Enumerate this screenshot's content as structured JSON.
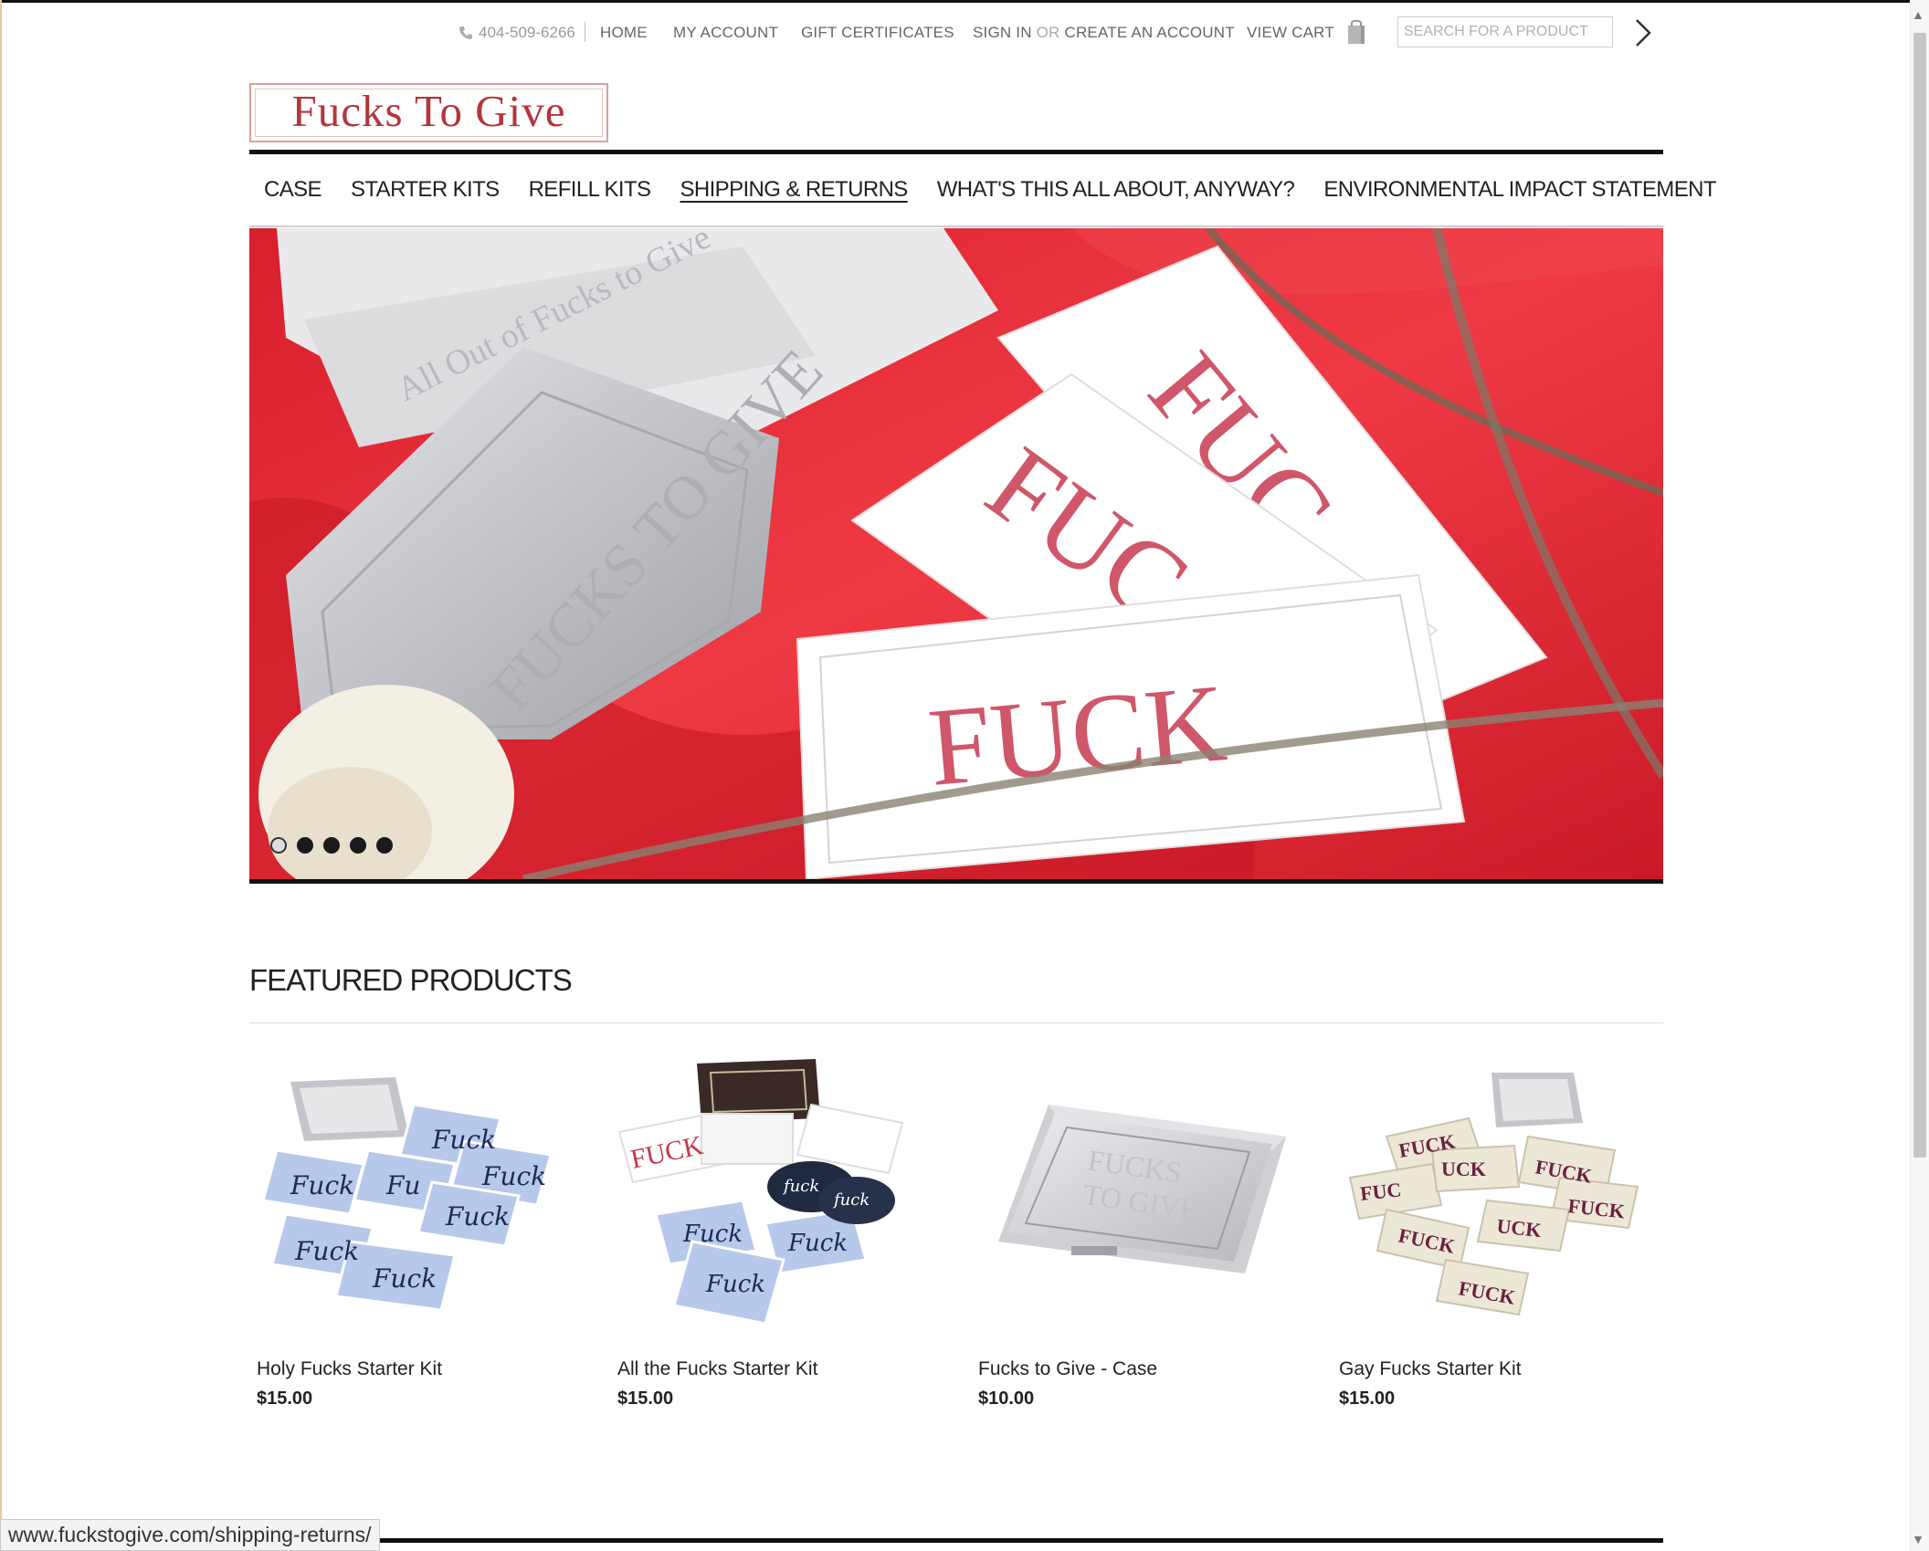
{
  "utility": {
    "phone": "404-509-6266",
    "home": "HOME",
    "my_account": "MY ACCOUNT",
    "gift_certificates": "GIFT CERTIFICATES",
    "sign_in": "SIGN IN",
    "or": "OR",
    "create_account": "CREATE AN ACCOUNT",
    "view_cart": "VIEW CART",
    "search_placeholder": "SEARCH FOR A PRODUCT"
  },
  "logo": {
    "text": "Fucks To Give"
  },
  "nav": {
    "items": [
      {
        "label": "CASE",
        "active": false
      },
      {
        "label": "STARTER KITS",
        "active": false
      },
      {
        "label": "REFILL KITS",
        "active": false
      },
      {
        "label": "SHIPPING & RETURNS",
        "active": true
      },
      {
        "label": "WHAT'S THIS ALL ABOUT, ANYWAY?",
        "active": false
      },
      {
        "label": "ENVIRONMENTAL IMPACT STATEMENT",
        "active": false
      }
    ]
  },
  "hero": {
    "slide_count": 5,
    "active_slide": 1,
    "image_text": {
      "case": "FUCKS TO GIVE",
      "card": "FUCK",
      "box": "All Out of Fucks to Give"
    }
  },
  "featured": {
    "title": "FEATURED PRODUCTS",
    "products": [
      {
        "name": "Holy Fucks Starter Kit",
        "price": "$15.00"
      },
      {
        "name": "All the Fucks Starter Kit",
        "price": "$15.00"
      },
      {
        "name": "Fucks to Give - Case",
        "price": "$10.00"
      },
      {
        "name": "Gay Fucks Starter Kit",
        "price": "$15.00"
      }
    ]
  },
  "status_bar": {
    "url": "www.fuckstogive.com/shipping-returns/"
  },
  "colors": {
    "brand_red": "#b3353c",
    "hero_red": "#e52a36",
    "rule": "#111111"
  }
}
